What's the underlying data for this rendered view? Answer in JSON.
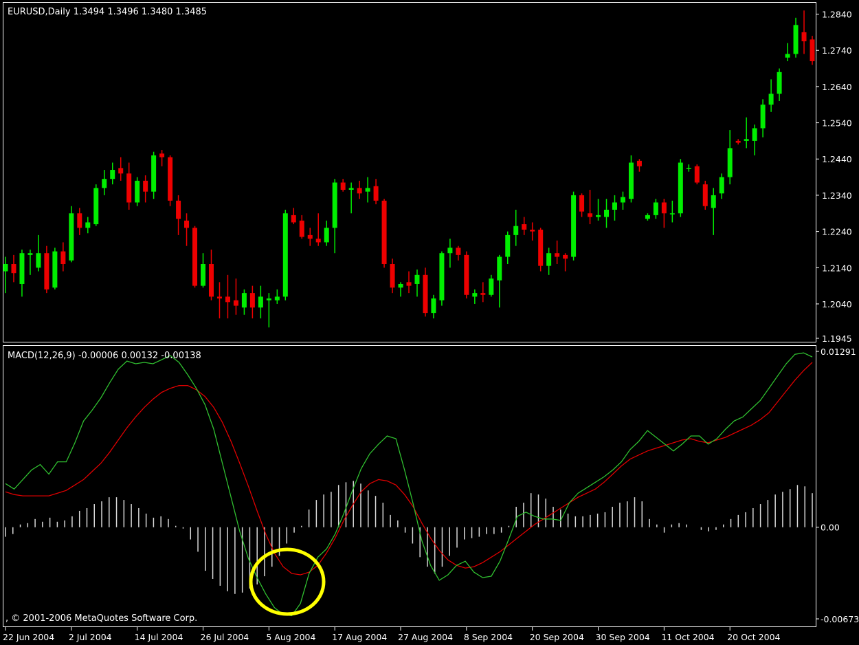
{
  "price_panel": {
    "header": "EURUSD,Daily  1.3494 1.3496 1.3480 1.3485",
    "y_ticks": [
      "1.2840",
      "1.2740",
      "1.2640",
      "1.2540",
      "1.2440",
      "1.2340",
      "1.2240",
      "1.2140",
      "1.2040",
      "1.1945"
    ]
  },
  "macd_panel": {
    "header": "MACD(12,26,9) -0.00006 0.00132 -0.00138",
    "y_ticks": [
      "0.01291",
      "0.00",
      "-0.00673"
    ],
    "copyright": ", © 2001-2006 MetaQuotes Software Corp."
  },
  "x_axis": {
    "labels": [
      "22 Jun 2004",
      "2 Jul 2004",
      "14 Jul 2004",
      "26 Jul 2004",
      "5 Aug 2004",
      "17 Aug 2004",
      "27 Aug 2004",
      "8 Sep 2004",
      "20 Sep 2004",
      "30 Sep 2004",
      "11 Oct 2004",
      "20 Oct 2004"
    ]
  },
  "colors": {
    "background": "#000000",
    "bull_candle": "#00ee00",
    "bear_candle": "#ee0000",
    "macd_line": "#30c030",
    "signal_line": "#e00000",
    "histogram": "#d8d8d8",
    "highlight_circle": "#ffff00"
  },
  "chart_data": [
    {
      "type": "candlestick",
      "symbol": "EURUSD",
      "timeframe": "Daily",
      "ylim": [
        1.1945,
        1.286
      ],
      "note_first_label_index": [
        0,
        8,
        16,
        24,
        32,
        40,
        48,
        56,
        64,
        72,
        80,
        88
      ],
      "candles": [
        {
          "o": 1.213,
          "h": 1.217,
          "l": 1.207,
          "c": 1.215
        },
        {
          "o": 1.215,
          "h": 1.2175,
          "l": 1.21,
          "c": 1.2125
        },
        {
          "o": 1.2095,
          "h": 1.219,
          "l": 1.206,
          "c": 1.218
        },
        {
          "o": 1.2175,
          "h": 1.219,
          "l": 1.212,
          "c": 1.218
        },
        {
          "o": 1.214,
          "h": 1.223,
          "l": 1.213,
          "c": 1.218
        },
        {
          "o": 1.218,
          "h": 1.22,
          "l": 1.207,
          "c": 1.208
        },
        {
          "o": 1.2085,
          "h": 1.2195,
          "l": 1.208,
          "c": 1.2185
        },
        {
          "o": 1.2185,
          "h": 1.221,
          "l": 1.213,
          "c": 1.215
        },
        {
          "o": 1.216,
          "h": 1.231,
          "l": 1.2155,
          "c": 1.229
        },
        {
          "o": 1.229,
          "h": 1.2305,
          "l": 1.223,
          "c": 1.225
        },
        {
          "o": 1.225,
          "h": 1.228,
          "l": 1.2235,
          "c": 1.2265
        },
        {
          "o": 1.226,
          "h": 1.237,
          "l": 1.2255,
          "c": 1.236
        },
        {
          "o": 1.236,
          "h": 1.241,
          "l": 1.234,
          "c": 1.2385
        },
        {
          "o": 1.2385,
          "h": 1.243,
          "l": 1.237,
          "c": 1.241
        },
        {
          "o": 1.2415,
          "h": 1.2445,
          "l": 1.238,
          "c": 1.24
        },
        {
          "o": 1.24,
          "h": 1.243,
          "l": 1.23,
          "c": 1.232
        },
        {
          "o": 1.232,
          "h": 1.239,
          "l": 1.231,
          "c": 1.238
        },
        {
          "o": 1.238,
          "h": 1.2395,
          "l": 1.232,
          "c": 1.235
        },
        {
          "o": 1.235,
          "h": 1.246,
          "l": 1.233,
          "c": 1.245
        },
        {
          "o": 1.2455,
          "h": 1.2465,
          "l": 1.242,
          "c": 1.2445
        },
        {
          "o": 1.2445,
          "h": 1.245,
          "l": 1.231,
          "c": 1.2325
        },
        {
          "o": 1.2325,
          "h": 1.234,
          "l": 1.223,
          "c": 1.2275
        },
        {
          "o": 1.227,
          "h": 1.229,
          "l": 1.22,
          "c": 1.225
        },
        {
          "o": 1.225,
          "h": 1.2255,
          "l": 1.2085,
          "c": 1.209
        },
        {
          "o": 1.209,
          "h": 1.218,
          "l": 1.2085,
          "c": 1.215
        },
        {
          "o": 1.215,
          "h": 1.219,
          "l": 1.205,
          "c": 1.206
        },
        {
          "o": 1.206,
          "h": 1.21,
          "l": 1.2,
          "c": 1.2055
        },
        {
          "o": 1.206,
          "h": 1.212,
          "l": 1.2,
          "c": 1.2045
        },
        {
          "o": 1.205,
          "h": 1.211,
          "l": 1.201,
          "c": 1.2035
        },
        {
          "o": 1.203,
          "h": 1.208,
          "l": 1.201,
          "c": 1.207
        },
        {
          "o": 1.207,
          "h": 1.209,
          "l": 1.2,
          "c": 1.203
        },
        {
          "o": 1.203,
          "h": 1.209,
          "l": 1.2,
          "c": 1.206
        },
        {
          "o": 1.205,
          "h": 1.207,
          "l": 1.1975,
          "c": 1.2055
        },
        {
          "o": 1.205,
          "h": 1.208,
          "l": 1.204,
          "c": 1.206
        },
        {
          "o": 1.206,
          "h": 1.23,
          "l": 1.205,
          "c": 1.229
        },
        {
          "o": 1.2285,
          "h": 1.2305,
          "l": 1.226,
          "c": 1.2265
        },
        {
          "o": 1.227,
          "h": 1.2285,
          "l": 1.222,
          "c": 1.2225
        },
        {
          "o": 1.223,
          "h": 1.225,
          "l": 1.22,
          "c": 1.222
        },
        {
          "o": 1.222,
          "h": 1.229,
          "l": 1.22,
          "c": 1.221
        },
        {
          "o": 1.221,
          "h": 1.227,
          "l": 1.22,
          "c": 1.225
        },
        {
          "o": 1.225,
          "h": 1.2385,
          "l": 1.218,
          "c": 1.2375
        },
        {
          "o": 1.2375,
          "h": 1.2385,
          "l": 1.235,
          "c": 1.2355
        },
        {
          "o": 1.2355,
          "h": 1.2375,
          "l": 1.229,
          "c": 1.236
        },
        {
          "o": 1.236,
          "h": 1.238,
          "l": 1.233,
          "c": 1.2345
        },
        {
          "o": 1.235,
          "h": 1.239,
          "l": 1.232,
          "c": 1.236
        },
        {
          "o": 1.2365,
          "h": 1.2385,
          "l": 1.2315,
          "c": 1.2325
        },
        {
          "o": 1.2325,
          "h": 1.233,
          "l": 1.214,
          "c": 1.215
        },
        {
          "o": 1.215,
          "h": 1.2165,
          "l": 1.207,
          "c": 1.2085
        },
        {
          "o": 1.2085,
          "h": 1.21,
          "l": 1.206,
          "c": 1.2095
        },
        {
          "o": 1.21,
          "h": 1.213,
          "l": 1.207,
          "c": 1.209
        },
        {
          "o": 1.2095,
          "h": 1.2135,
          "l": 1.206,
          "c": 1.212
        },
        {
          "o": 1.212,
          "h": 1.214,
          "l": 1.2005,
          "c": 1.2015
        },
        {
          "o": 1.2015,
          "h": 1.2065,
          "l": 1.2,
          "c": 1.2055
        },
        {
          "o": 1.205,
          "h": 1.2185,
          "l": 1.2035,
          "c": 1.218
        },
        {
          "o": 1.218,
          "h": 1.222,
          "l": 1.214,
          "c": 1.2195
        },
        {
          "o": 1.2195,
          "h": 1.22,
          "l": 1.216,
          "c": 1.2175
        },
        {
          "o": 1.2175,
          "h": 1.2185,
          "l": 1.2055,
          "c": 1.2065
        },
        {
          "o": 1.206,
          "h": 1.208,
          "l": 1.204,
          "c": 1.207
        },
        {
          "o": 1.207,
          "h": 1.21,
          "l": 1.2045,
          "c": 1.2065
        },
        {
          "o": 1.2065,
          "h": 1.212,
          "l": 1.206,
          "c": 1.211
        },
        {
          "o": 1.2105,
          "h": 1.2175,
          "l": 1.203,
          "c": 1.217
        },
        {
          "o": 1.217,
          "h": 1.224,
          "l": 1.215,
          "c": 1.223
        },
        {
          "o": 1.223,
          "h": 1.23,
          "l": 1.22,
          "c": 1.2255
        },
        {
          "o": 1.226,
          "h": 1.228,
          "l": 1.223,
          "c": 1.2245
        },
        {
          "o": 1.2245,
          "h": 1.2265,
          "l": 1.2215,
          "c": 1.224
        },
        {
          "o": 1.2245,
          "h": 1.225,
          "l": 1.213,
          "c": 1.2145
        },
        {
          "o": 1.2145,
          "h": 1.2195,
          "l": 1.212,
          "c": 1.218
        },
        {
          "o": 1.218,
          "h": 1.2215,
          "l": 1.215,
          "c": 1.217
        },
        {
          "o": 1.2175,
          "h": 1.218,
          "l": 1.213,
          "c": 1.2165
        },
        {
          "o": 1.217,
          "h": 1.235,
          "l": 1.216,
          "c": 1.234
        },
        {
          "o": 1.234,
          "h": 1.2345,
          "l": 1.228,
          "c": 1.2295
        },
        {
          "o": 1.229,
          "h": 1.2355,
          "l": 1.226,
          "c": 1.228
        },
        {
          "o": 1.228,
          "h": 1.233,
          "l": 1.227,
          "c": 1.2285
        },
        {
          "o": 1.228,
          "h": 1.233,
          "l": 1.225,
          "c": 1.23
        },
        {
          "o": 1.23,
          "h": 1.234,
          "l": 1.227,
          "c": 1.232
        },
        {
          "o": 1.232,
          "h": 1.235,
          "l": 1.23,
          "c": 1.2335
        },
        {
          "o": 1.233,
          "h": 1.245,
          "l": 1.232,
          "c": 1.243
        },
        {
          "o": 1.2435,
          "h": 1.244,
          "l": 1.2405,
          "c": 1.242
        },
        {
          "o": 1.2275,
          "h": 1.229,
          "l": 1.227,
          "c": 1.2285
        },
        {
          "o": 1.2285,
          "h": 1.233,
          "l": 1.2275,
          "c": 1.232
        },
        {
          "o": 1.232,
          "h": 1.233,
          "l": 1.225,
          "c": 1.229
        },
        {
          "o": 1.229,
          "h": 1.2325,
          "l": 1.2265,
          "c": 1.229
        },
        {
          "o": 1.229,
          "h": 1.244,
          "l": 1.228,
          "c": 1.243
        },
        {
          "o": 1.2415,
          "h": 1.2425,
          "l": 1.2405,
          "c": 1.2415
        },
        {
          "o": 1.242,
          "h": 1.2425,
          "l": 1.237,
          "c": 1.2375
        },
        {
          "o": 1.237,
          "h": 1.238,
          "l": 1.23,
          "c": 1.231
        },
        {
          "o": 1.2305,
          "h": 1.236,
          "l": 1.223,
          "c": 1.234
        },
        {
          "o": 1.2345,
          "h": 1.24,
          "l": 1.233,
          "c": 1.239
        },
        {
          "o": 1.239,
          "h": 1.252,
          "l": 1.237,
          "c": 1.247
        },
        {
          "o": 1.249,
          "h": 1.2495,
          "l": 1.248,
          "c": 1.2485
        },
        {
          "o": 1.249,
          "h": 1.2555,
          "l": 1.247,
          "c": 1.2495
        },
        {
          "o": 1.249,
          "h": 1.2535,
          "l": 1.245,
          "c": 1.2525
        },
        {
          "o": 1.2525,
          "h": 1.2605,
          "l": 1.25,
          "c": 1.259
        },
        {
          "o": 1.259,
          "h": 1.266,
          "l": 1.257,
          "c": 1.262
        },
        {
          "o": 1.262,
          "h": 1.269,
          "l": 1.26,
          "c": 1.268
        },
        {
          "o": 1.272,
          "h": 1.276,
          "l": 1.271,
          "c": 1.273
        },
        {
          "o": 1.273,
          "h": 1.283,
          "l": 1.272,
          "c": 1.281
        },
        {
          "o": 1.279,
          "h": 1.285,
          "l": 1.273,
          "c": 1.2765
        },
        {
          "o": 1.277,
          "h": 1.278,
          "l": 1.27,
          "c": 1.271
        }
      ]
    },
    {
      "type": "macd",
      "name": "MACD(12,26,9)",
      "ylim": [
        -0.00673,
        0.01291
      ],
      "macd": [
        0.0032,
        0.0028,
        0.0035,
        0.0042,
        0.0046,
        0.0039,
        0.0048,
        0.0048,
        0.0062,
        0.0078,
        0.0086,
        0.0095,
        0.0106,
        0.0116,
        0.0122,
        0.012,
        0.0121,
        0.012,
        0.0123,
        0.0126,
        0.0121,
        0.0112,
        0.0102,
        0.009,
        0.0072,
        0.0047,
        0.0022,
        -0.0003,
        -0.0023,
        -0.0037,
        -0.0049,
        -0.0059,
        -0.0064,
        -0.0065,
        -0.0056,
        -0.0034,
        -0.0022,
        -0.0016,
        -0.0005,
        0.001,
        0.0027,
        0.0043,
        0.0054,
        0.0061,
        0.0067,
        0.0065,
        0.0042,
        0.0017,
        -0.001,
        -0.0028,
        -0.0039,
        -0.0035,
        -0.0028,
        -0.0025,
        -0.0033,
        -0.0037,
        -0.0036,
        -0.0025,
        -0.0009,
        0.0008,
        0.0011,
        0.0008,
        0.0006,
        0.0006,
        0.0005,
        0.0018,
        0.0025,
        0.0029,
        0.0033,
        0.0037,
        0.0042,
        0.0048,
        0.0057,
        0.0063,
        0.0071,
        0.0066,
        0.0061,
        0.0056,
        0.0061,
        0.0067,
        0.0067,
        0.0061,
        0.0065,
        0.0072,
        0.0078,
        0.0081,
        0.0087,
        0.0093,
        0.0102,
        0.0111,
        0.012,
        0.0127,
        0.0128,
        0.0125
      ],
      "signal": [
        0.0026,
        0.0024,
        0.0023,
        0.0023,
        0.0023,
        0.0023,
        0.0025,
        0.0027,
        0.0031,
        0.0035,
        0.0041,
        0.0047,
        0.0055,
        0.0064,
        0.0073,
        0.0081,
        0.0088,
        0.0094,
        0.0099,
        0.0102,
        0.0104,
        0.0104,
        0.0101,
        0.0096,
        0.0088,
        0.0077,
        0.0063,
        0.0047,
        0.003,
        0.0012,
        -0.0005,
        -0.0019,
        -0.0029,
        -0.0034,
        -0.0035,
        -0.0033,
        -0.0028,
        -0.0019,
        -0.0008,
        0.0005,
        0.0016,
        0.0026,
        0.0032,
        0.0035,
        0.0034,
        0.0031,
        0.0024,
        0.0015,
        0.0003,
        -0.0008,
        -0.0017,
        -0.0024,
        -0.0028,
        -0.003,
        -0.0029,
        -0.0026,
        -0.0022,
        -0.0018,
        -0.0013,
        -0.0008,
        -0.0003,
        0.0002,
        0.0006,
        0.001,
        0.0014,
        0.0018,
        0.0022,
        0.0025,
        0.0028,
        0.0033,
        0.0039,
        0.0045,
        0.005,
        0.0053,
        0.0056,
        0.0058,
        0.006,
        0.0062,
        0.0064,
        0.0065,
        0.0063,
        0.0062,
        0.0064,
        0.0066,
        0.0069,
        0.0072,
        0.0075,
        0.0079,
        0.0084,
        0.0092,
        0.01,
        0.0108,
        0.0115,
        0.0121
      ],
      "histogram": [
        -0.0007,
        -0.0005,
        0.0002,
        0.0003,
        0.0006,
        0.0004,
        0.0007,
        0.0004,
        0.0005,
        0.0008,
        0.0012,
        0.0014,
        0.0017,
        0.0019,
        0.0022,
        0.0022,
        0.002,
        0.0017,
        0.0014,
        0.001,
        0.0007,
        0.0008,
        0.0006,
        0.0001,
        -0.0001,
        -0.0009,
        -0.0018,
        -0.0032,
        -0.0038,
        -0.0043,
        -0.0047,
        -0.0049,
        -0.0048,
        -0.0045,
        -0.0042,
        -0.0036,
        -0.0029,
        -0.0021,
        -0.0012,
        -0.0004,
        0.0001,
        0.0013,
        0.002,
        0.0024,
        0.0026,
        0.0031,
        0.0033,
        0.0034,
        0.0032,
        0.0027,
        0.0023,
        0.0018,
        0.0009,
        0.0005,
        -0.0004,
        -0.0012,
        -0.0022,
        -0.0029,
        -0.0034,
        -0.0029,
        -0.0021,
        -0.0015,
        -0.0009,
        -0.0008,
        -0.0007,
        -0.0005,
        -0.0005,
        -0.0004,
        0.0001,
        0.0015,
        0.0018,
        0.0025,
        0.0024,
        0.0021,
        0.0015,
        0.0013,
        0.001,
        0.0008,
        0.0008,
        0.0009,
        0.001,
        0.0011,
        0.0015,
        0.0018,
        0.0019,
        0.0022,
        0.0019,
        0.0006,
        0.0002,
        -0.0004,
        0.0002,
        0.0003,
        0.0002,
        0.0,
        -0.0002,
        -0.0003,
        -0.0002,
        0.0002,
        0.0006,
        0.0009,
        0.0011,
        0.0014,
        0.0017,
        0.002,
        0.0024,
        0.0026,
        0.0028,
        0.0031,
        0.003,
        0.0025
      ]
    }
  ]
}
